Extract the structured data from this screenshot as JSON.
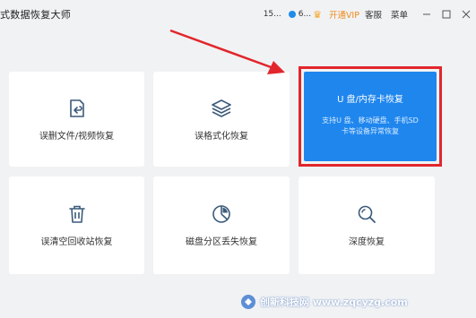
{
  "titlebar": {
    "app_title": "式数据恢复大师",
    "account_number": "15...",
    "account_short": "6...",
    "vip_label": "开通VIP",
    "service_label": "客服",
    "menu_label": "菜单",
    "minimize_glyph": "—",
    "maximize_glyph": "☐",
    "close_glyph": "✕"
  },
  "cards": {
    "file_video": {
      "label": "误删文件/视频恢复",
      "icon": "file-restore-icon"
    },
    "format": {
      "label": "误格式化恢复",
      "icon": "layers-icon"
    },
    "usb": {
      "title": "U 盘/内存卡恢复",
      "description": "支持U 盘、移动硬盘、手机SD卡等设备异常恢复",
      "icon": "none"
    },
    "recycle_bin": {
      "label": "误清空回收站恢复",
      "icon": "trash-icon"
    },
    "partition": {
      "label": "磁盘分区丢失恢复",
      "icon": "pie-chart-icon"
    },
    "deep": {
      "label": "深度恢复",
      "icon": "magnifier-icon"
    }
  },
  "watermark": {
    "text": "创新科技网 www.zqcyzg.com"
  },
  "colors": {
    "accent_blue": "#1f86ee",
    "highlight_red": "#e2262b",
    "vip_orange": "#f08a1c",
    "icon_stroke": "#3b5a7a"
  }
}
